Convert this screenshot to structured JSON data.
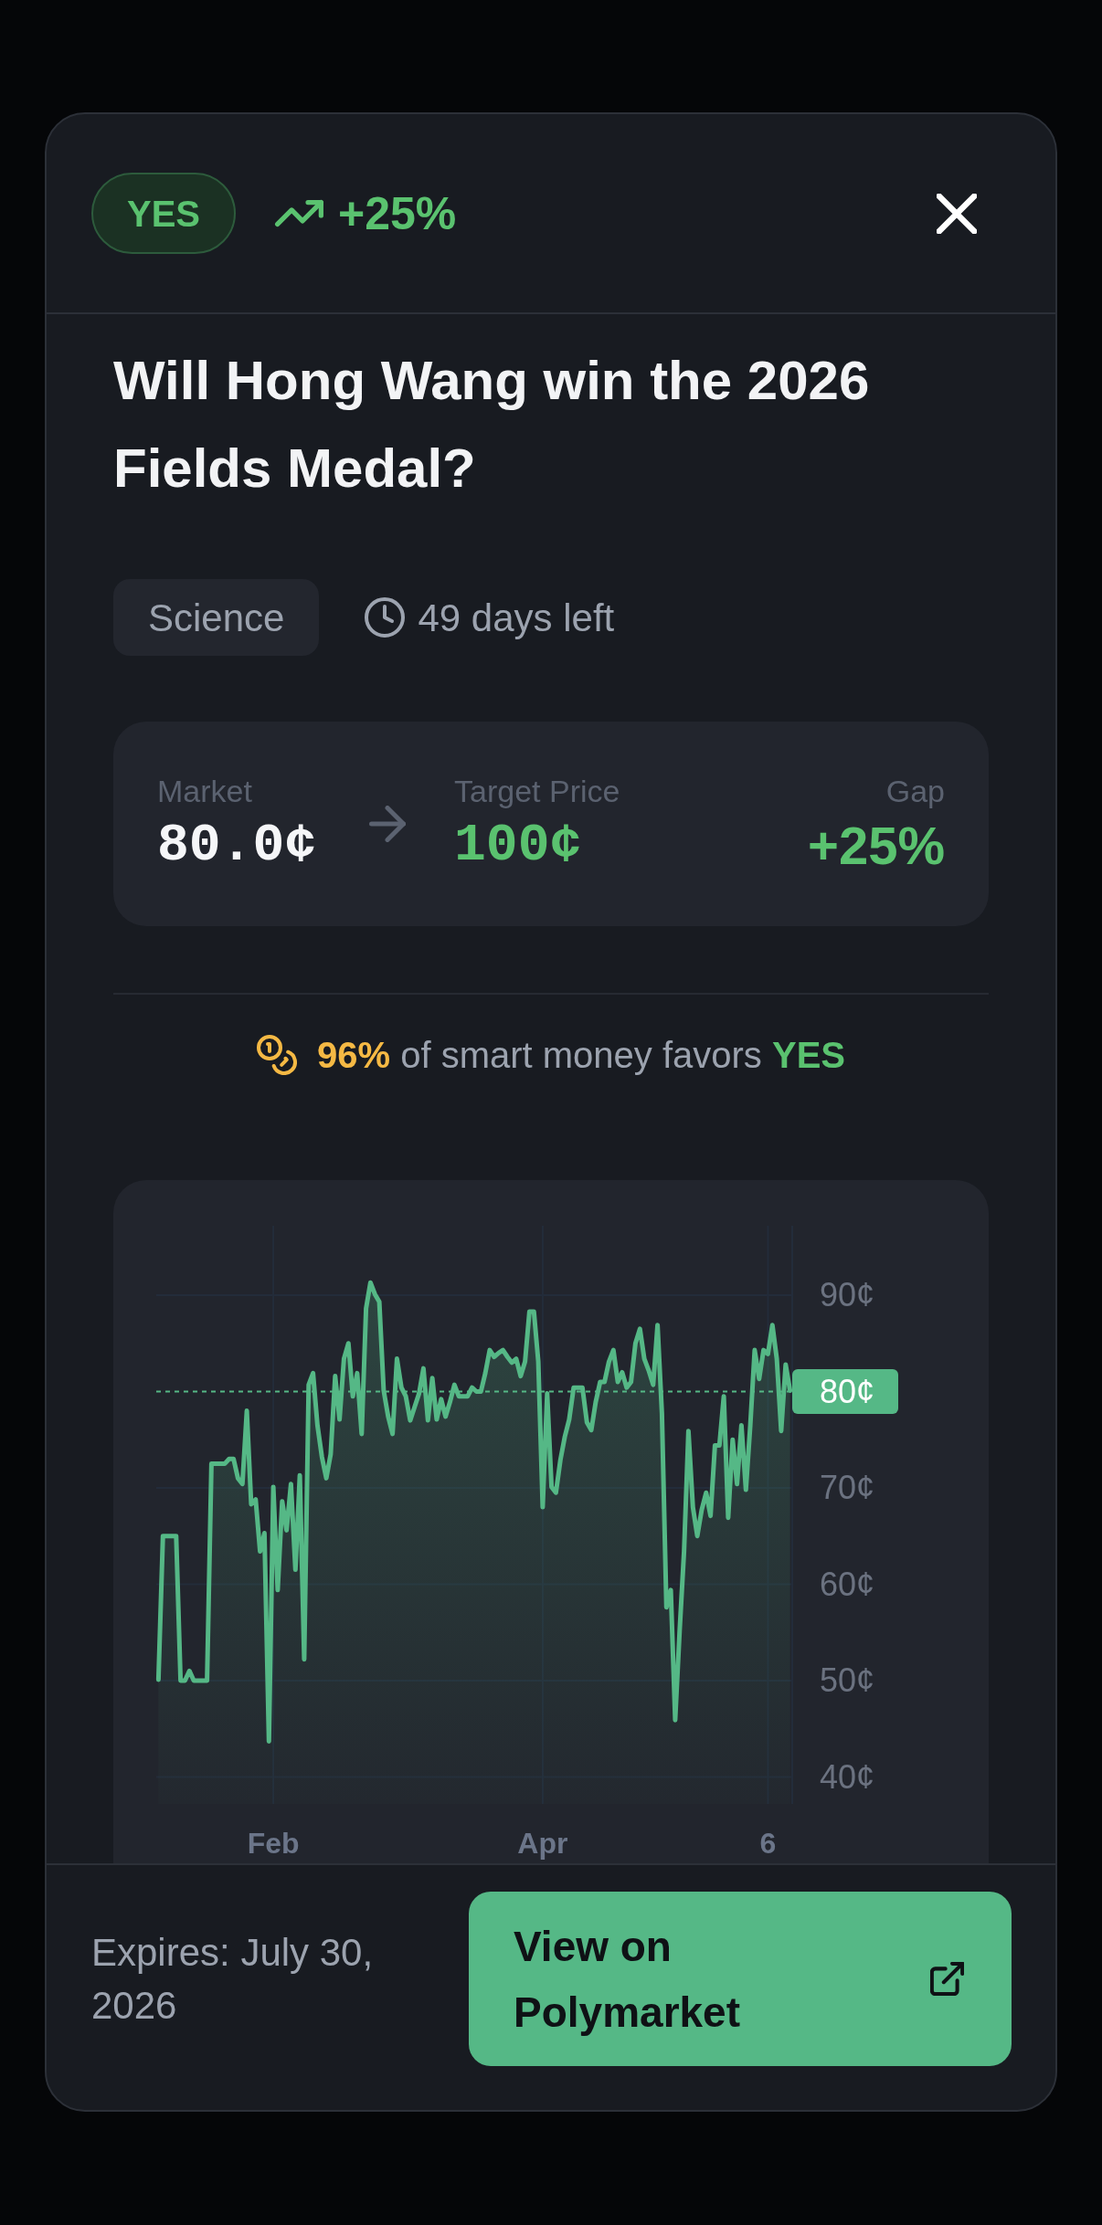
{
  "header": {
    "badge": {
      "label": "YES",
      "kind": "yes"
    },
    "change": "+25%"
  },
  "title": "Will Hong Wang win the 2026 Fields Medal?",
  "meta": {
    "category": "Science",
    "time_left": "49 days left"
  },
  "price_summary": [
    {
      "label": "Market",
      "value": "80.0¢",
      "kind": "current"
    },
    {
      "label": "Target Price",
      "value": "100¢",
      "kind": "target"
    },
    {
      "label": "Gap",
      "value": "+25%",
      "kind": "gap"
    }
  ],
  "smart_money": {
    "share": "96%",
    "text": "of smart money favors",
    "side": "YES"
  },
  "chart": {
    "chart_data": {
      "type": "area",
      "grid": true,
      "categories": [
        null,
        null,
        null,
        null,
        null,
        null,
        null,
        null,
        null,
        null,
        null,
        null,
        null,
        null,
        null,
        null,
        null,
        null,
        null,
        null,
        null,
        null,
        null,
        null,
        null,
        null,
        "Feb",
        null,
        null,
        null,
        null,
        null,
        null,
        null,
        null,
        null,
        null,
        null,
        null,
        null,
        null,
        null,
        null,
        null,
        null,
        null,
        null,
        null,
        null,
        null,
        null,
        null,
        null,
        null,
        null,
        null,
        null,
        null,
        null,
        null,
        null,
        null,
        null,
        null,
        null,
        null,
        null,
        null,
        null,
        null,
        null,
        null,
        null,
        null,
        null,
        null,
        null,
        null,
        null,
        null,
        null,
        null,
        null,
        null,
        null,
        null,
        null,
        "Apr",
        null,
        null,
        null,
        null,
        null,
        null,
        null,
        null,
        null,
        null,
        null,
        null,
        null,
        null,
        null,
        null,
        null,
        null,
        null,
        null,
        null,
        null,
        null,
        null,
        null,
        null,
        null,
        null,
        null,
        null,
        null,
        null,
        null,
        null,
        null,
        null,
        null,
        null,
        null,
        null,
        null,
        null,
        null,
        null,
        null,
        null,
        null,
        null,
        null,
        null,
        "6",
        null,
        null,
        null,
        null,
        null
      ],
      "series": [
        {
          "color": "#55b886",
          "values": [
            50.1,
            65,
            65,
            65,
            65,
            50,
            50,
            51,
            50,
            50,
            50,
            50,
            72.5,
            72.5,
            72.5,
            72.5,
            73,
            73,
            71,
            70.4,
            78,
            68.3,
            68.8,
            63.4,
            65.3,
            43.7,
            70.1,
            59.4,
            68.6,
            65.6,
            70.4,
            61.5,
            71.3,
            52.2,
            80.7,
            81.9,
            76.5,
            73.2,
            71,
            73.5,
            81.6,
            77.1,
            83.4,
            85,
            79.5,
            81.9,
            75.6,
            88.6,
            91.3,
            90.1,
            89.3,
            80.1,
            77.4,
            75.6,
            83.4,
            80.4,
            79.5,
            77,
            78.4,
            79.8,
            82.4,
            77,
            81.4,
            77.1,
            79.2,
            77.4,
            78.9,
            80.7,
            79.5,
            79.5,
            79.5,
            80.4,
            80,
            80,
            81.9,
            84.3,
            83.6,
            84,
            84.3,
            83.6,
            83,
            83.4,
            81.6,
            83.1,
            88.3,
            88.3,
            83.1,
            68,
            79.8,
            70.1,
            69.5,
            72.9,
            75.3,
            77.1,
            80.4,
            80.4,
            80.4,
            76.8,
            76,
            78.9,
            81,
            81,
            83.1,
            84.3,
            81,
            82,
            80.4,
            81,
            85,
            86.5,
            83.4,
            82.2,
            80.7,
            86.9,
            77.7,
            57.6,
            59.4,
            45.9,
            55.2,
            63.4,
            75.9,
            68,
            65,
            67.7,
            69.5,
            67.1,
            74.4,
            74.4,
            79.5,
            66.9,
            75,
            70.4,
            76.5,
            69.8,
            76.5,
            84.3,
            81.3,
            84.3,
            83.9,
            86.9,
            83.4,
            75.9,
            82.8,
            80.1
          ]
        }
      ],
      "ylim": [
        37.2,
        97.2
      ],
      "yticks": [
        {
          "value": 40,
          "label": "40¢"
        },
        {
          "value": 50,
          "label": "50¢"
        },
        {
          "value": 60,
          "label": "60¢"
        },
        {
          "value": 70,
          "label": "70¢"
        },
        {
          "value": 80,
          "label": "80¢"
        },
        {
          "value": 90,
          "label": "90¢"
        }
      ],
      "ref_lines": [
        {
          "axis": "y",
          "value": 80,
          "color": "#55b886"
        }
      ]
    }
  },
  "footer": {
    "expires": "Expires: July 30, 2026",
    "button": "View on Polymarket"
  }
}
